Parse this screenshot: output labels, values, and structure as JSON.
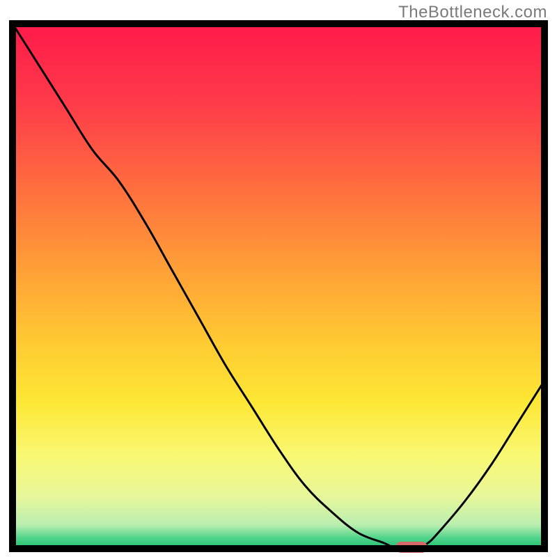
{
  "watermark": "TheBottleneck.com",
  "chart_data": {
    "type": "line",
    "title": "",
    "xlabel": "",
    "ylabel": "",
    "x": [
      0,
      5,
      10,
      15,
      20,
      25,
      30,
      35,
      40,
      45,
      50,
      55,
      60,
      65,
      70,
      72,
      74,
      76,
      78,
      80,
      85,
      90,
      95,
      100
    ],
    "y": [
      100,
      92,
      84,
      76,
      70,
      62,
      53,
      44,
      35,
      27,
      19,
      12,
      7,
      3,
      1,
      0,
      0,
      0,
      1,
      3,
      9,
      16,
      24,
      32
    ],
    "xlim": [
      0,
      100
    ],
    "ylim": [
      0,
      100
    ],
    "marker": {
      "x_center": 75,
      "x_start": 72,
      "x_end": 78,
      "y": 0,
      "color": "#d66a6a"
    },
    "background_gradient": {
      "stops": [
        {
          "offset": 0.0,
          "color": "#ff1a4a"
        },
        {
          "offset": 0.15,
          "color": "#ff3a4a"
        },
        {
          "offset": 0.3,
          "color": "#ff6a3f"
        },
        {
          "offset": 0.45,
          "color": "#ff9a38"
        },
        {
          "offset": 0.6,
          "color": "#ffc832"
        },
        {
          "offset": 0.72,
          "color": "#fde734"
        },
        {
          "offset": 0.82,
          "color": "#f9f871"
        },
        {
          "offset": 0.9,
          "color": "#e8f79a"
        },
        {
          "offset": 0.955,
          "color": "#b9eeb0"
        },
        {
          "offset": 0.98,
          "color": "#4fd38a"
        },
        {
          "offset": 1.0,
          "color": "#1fbf6f"
        }
      ]
    },
    "frame_color": "#000000",
    "line_color": "#000000",
    "line_width": 3
  }
}
